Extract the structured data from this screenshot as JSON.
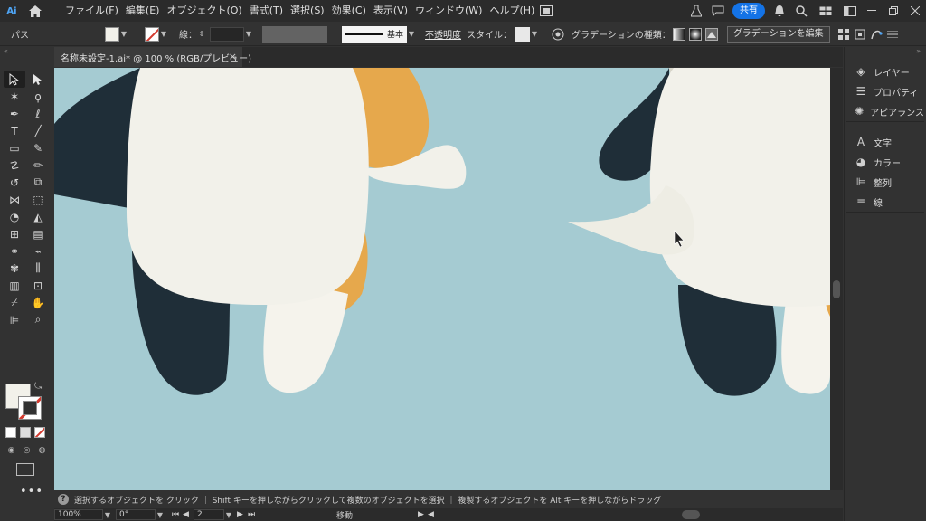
{
  "menubar": {
    "app_logo": "Ai",
    "home_icon": "home-icon",
    "menus": [
      "ファイル(F)",
      "編集(E)",
      "オブジェクト(O)",
      "書式(T)",
      "選択(S)",
      "効果(C)",
      "表示(V)",
      "ウィンドウ(W)",
      "ヘルプ(H)"
    ],
    "share_label": "共有"
  },
  "controlbar": {
    "object_type": "パス",
    "stroke_label": "線：",
    "stroke_style_label": "基本",
    "opacity_label": "不透明度",
    "style_label": "スタイル：",
    "gradient_type_label": "グラデーションの種類：",
    "edit_gradient_label": "グラデーションを編集"
  },
  "document_tab": {
    "title": "名称未設定-1.ai* @ 100 % (RGB/プレビュー)",
    "close": "×"
  },
  "panels": {
    "group1": [
      "レイヤー",
      "プロパティ",
      "アピアランス"
    ],
    "group2": [
      "文字",
      "カラー",
      "整列",
      "線"
    ]
  },
  "hint": {
    "question": "?",
    "text": "選択するオブジェクトを クリック ｜ Shift キーを押しながらクリックして複数のオブジェクトを選択 ｜ 複製するオブジェクトを Alt キーを押しながらドラッグ"
  },
  "status": {
    "zoom": "100%",
    "rotation": "0°",
    "artboard": "2",
    "tool": "移動"
  },
  "colors": {
    "canvas_bg": "#a5cbd2",
    "cream": "#f2f1ea",
    "dark_navy": "#1f2e38",
    "orange": "#e6a84c",
    "accent_blue": "#1473e6"
  }
}
